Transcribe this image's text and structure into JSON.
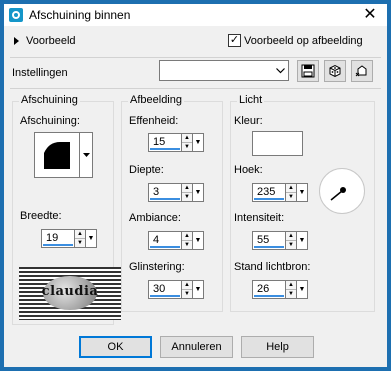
{
  "window": {
    "title": "Afschuining binnen"
  },
  "preview": {
    "label": "Voorbeeld",
    "checkbox_label": "Voorbeeld op afbeelding",
    "checked": true
  },
  "settings": {
    "label": "Instellingen",
    "value": ""
  },
  "bevel_group": {
    "title": "Afschuining",
    "shape_label": "Afschuining:",
    "width_label": "Breedte:",
    "width_value": "19",
    "logo_text": "claudia"
  },
  "image_group": {
    "title": "Afbeelding",
    "smoothness_label": "Effenheid:",
    "smoothness_value": "15",
    "depth_label": "Diepte:",
    "depth_value": "3",
    "ambience_label": "Ambiance:",
    "ambience_value": "4",
    "shininess_label": "Glinstering:",
    "shininess_value": "30"
  },
  "light_group": {
    "title": "Licht",
    "color_label": "Kleur:",
    "color": "#ffffff",
    "angle_label": "Hoek:",
    "angle_value": "235",
    "intensity_label": "Intensiteit:",
    "intensity_value": "55",
    "elevation_label": "Stand lichtbron:",
    "elevation_value": "26"
  },
  "buttons": {
    "ok": "OK",
    "cancel": "Annuleren",
    "help": "Help"
  }
}
